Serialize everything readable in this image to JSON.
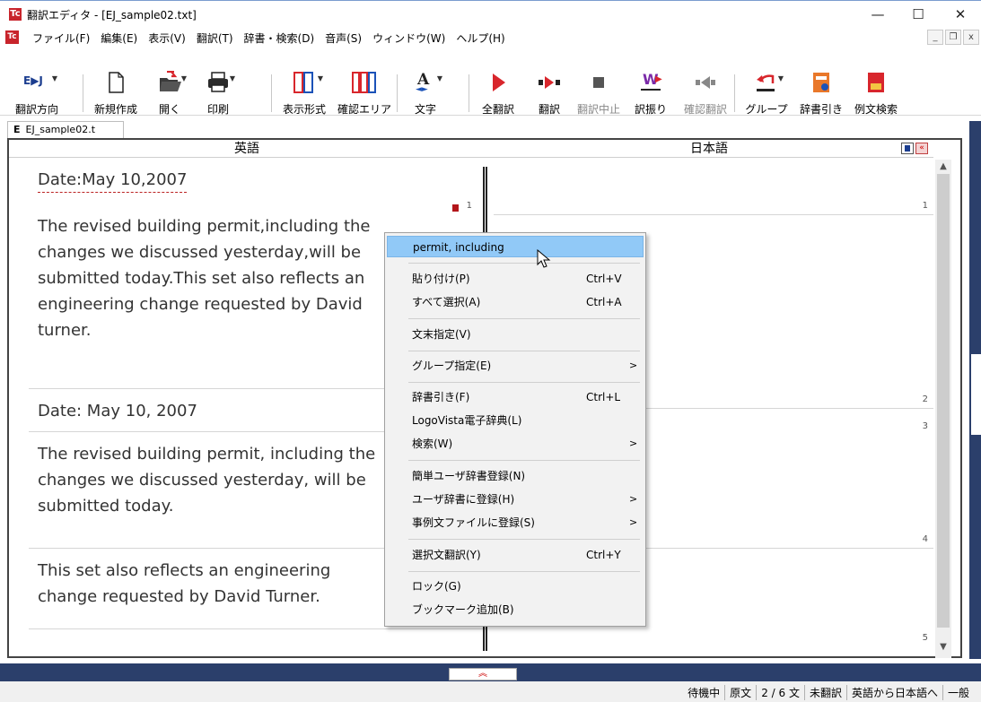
{
  "window": {
    "title": "翻訳エディタ - [EJ_sample02.txt]",
    "app_icon_text": "Tc",
    "minimize": "—",
    "maximize": "☐",
    "close": "✕"
  },
  "menubar": {
    "items": [
      "ファイル(F)",
      "編集(E)",
      "表示(V)",
      "翻訳(T)",
      "辞書・検索(D)",
      "音声(S)",
      "ウィンドウ(W)",
      "ヘルプ(H)"
    ],
    "mdi_minimize": "_",
    "mdi_restore": "❐",
    "mdi_close": "x"
  },
  "toolbar": {
    "direction": "翻訳方向",
    "direction_icon_text": "E▶J",
    "new": "新規作成",
    "open": "開く",
    "print": "印刷",
    "display_format": "表示形式",
    "confirm_area": "確認エリア",
    "font": "文字",
    "translate_all": "全翻訳",
    "translate": "翻訳",
    "stop": "翻訳中止",
    "assign": "訳振り",
    "confirm_translation": "確認翻訳",
    "group": "グループ",
    "dictionary": "辞書引き",
    "example_search": "例文検索"
  },
  "document": {
    "tab_letter": "E",
    "tab_name": "EJ_sample02.t",
    "source_header": "英語",
    "target_header": "日本語"
  },
  "segments": [
    {
      "num": "1",
      "lines": [
        "Date:May 10,2007"
      ]
    },
    {
      "num": "1",
      "lines": [
        "The revised building permit,including the",
        "changes we discussed yesterday,will be",
        "submitted today.This set also reflects an",
        "engineering change requested by David",
        "turner."
      ]
    },
    {
      "num": "2",
      "lines": [
        "Date: May 10, 2007"
      ]
    },
    {
      "num": "3",
      "lines": [
        "The revised building permit, including the",
        "changes we discussed yesterday, will be",
        "submitted today."
      ]
    },
    {
      "num": "4",
      "lines": [
        "This set also reflects an engineering",
        "change requested by David Turner."
      ]
    },
    {
      "num": "5",
      "lines": []
    }
  ],
  "context_menu": {
    "highlighted": "permit, including",
    "paste": "貼り付け(P)",
    "paste_sc": "Ctrl+V",
    "select_all": "すべて選択(A)",
    "select_all_sc": "Ctrl+A",
    "sentence_end": "文末指定(V)",
    "group_assign": "グループ指定(E)",
    "dict_lookup": "辞書引き(F)",
    "dict_lookup_sc": "Ctrl+L",
    "logovista": "LogoVista電子辞典(L)",
    "search": "検索(W)",
    "simple_user_dict": "簡単ユーザ辞書登録(N)",
    "register_user_dict": "ユーザ辞書に登録(H)",
    "register_example": "事例文ファイルに登録(S)",
    "translate_selected": "選択文翻訳(Y)",
    "translate_selected_sc": "Ctrl+Y",
    "lock": "ロック(G)",
    "bookmark": "ブックマーク追加(B)",
    "submenu_arrow": ">"
  },
  "status": {
    "state": "待機中",
    "source": "原文",
    "position": "2 / 6 文",
    "translated": "未翻訳",
    "direction": "英語から日本語へ",
    "field": "一般"
  },
  "colors": {
    "accent_red": "#c8242b",
    "highlight_blue": "#91c9f7",
    "frame_navy": "#2b3f6b"
  }
}
